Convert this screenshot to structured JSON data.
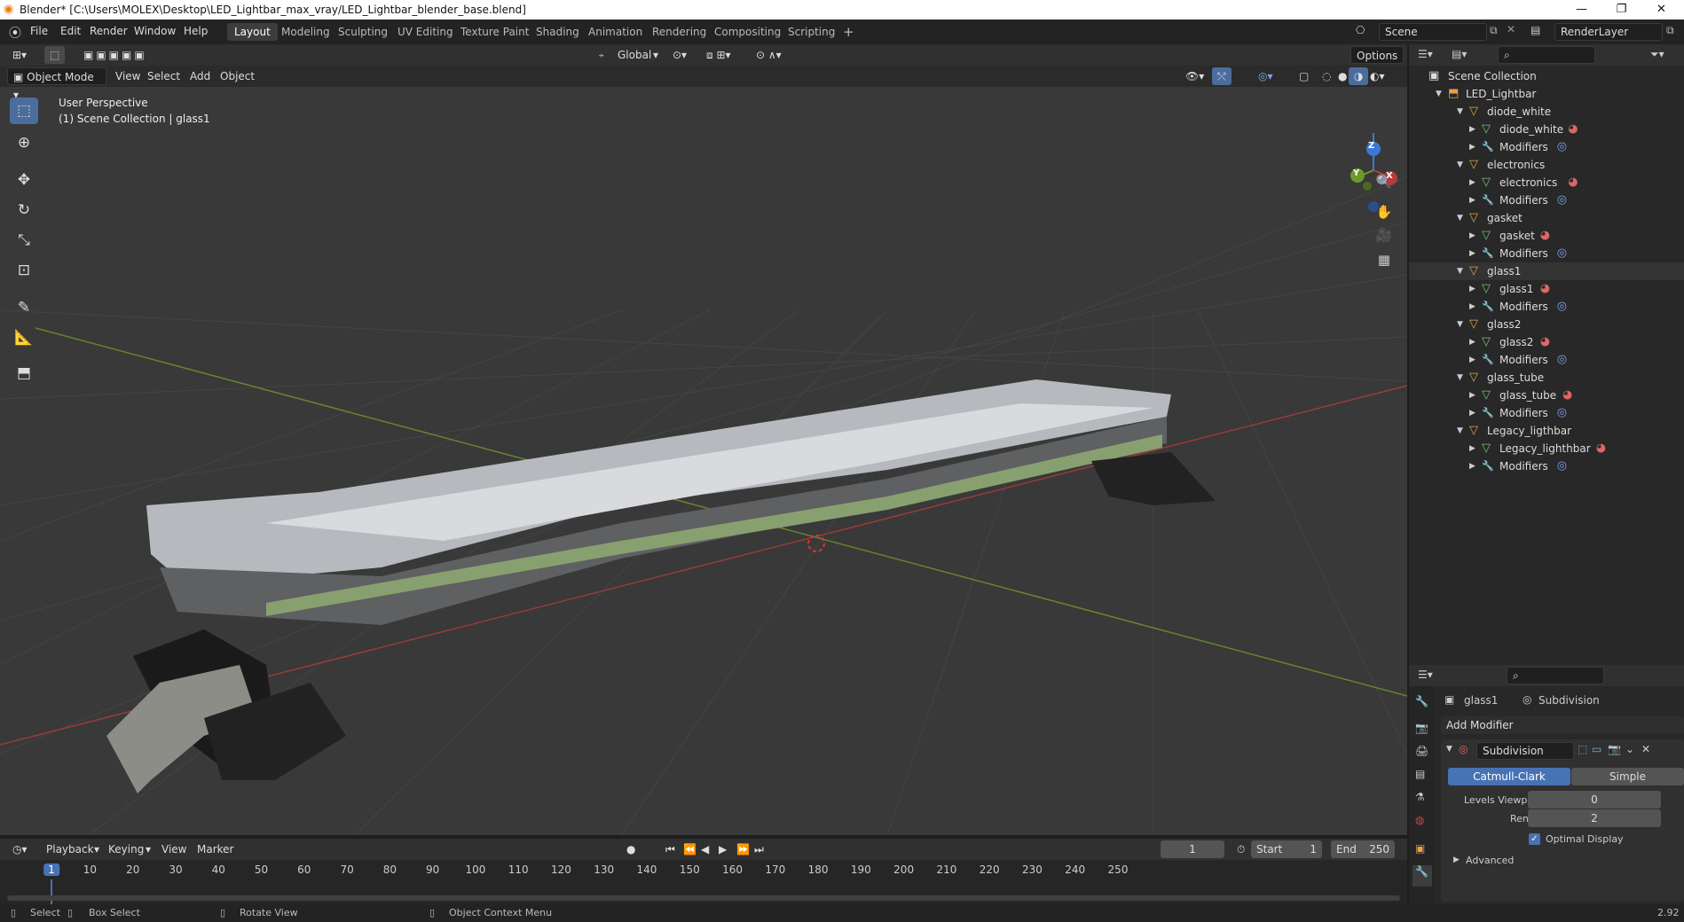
{
  "window": {
    "title": "Blender* [C:\\Users\\MOLEX\\Desktop\\LED_Lightbar_max_vray/LED_Lightbar_blender_base.blend]",
    "controls": [
      "—",
      "❐",
      "✕"
    ]
  },
  "menu": [
    "File",
    "Edit",
    "Render",
    "Window",
    "Help"
  ],
  "workspaces": [
    "Layout",
    "Modeling",
    "Sculpting",
    "UV Editing",
    "Texture Paint",
    "Shading",
    "Animation",
    "Rendering",
    "Compositing",
    "Scripting"
  ],
  "scene": {
    "name": "Scene",
    "render_layer": "RenderLayer"
  },
  "viewport": {
    "mode": "Object Mode",
    "menus": [
      "View",
      "Select",
      "Add",
      "Object"
    ],
    "transform_orientation": "Global",
    "options_label": "Options",
    "info_line1": "User Perspective",
    "info_line2": "(1) Scene Collection | glass1",
    "gizmo": {
      "x": "X",
      "y": "Y",
      "z": "Z"
    }
  },
  "outliner": {
    "root": "Scene Collection",
    "collection": "LED_Lightbar",
    "rows": [
      {
        "label": "diode_white",
        "kind": "object"
      },
      {
        "label": "diode_white",
        "kind": "mesh"
      },
      {
        "label": "Modifiers",
        "kind": "modifiers"
      },
      {
        "label": "electronics",
        "kind": "object"
      },
      {
        "label": "electronics",
        "kind": "mesh"
      },
      {
        "label": "Modifiers",
        "kind": "modifiers"
      },
      {
        "label": "gasket",
        "kind": "object"
      },
      {
        "label": "gasket",
        "kind": "mesh"
      },
      {
        "label": "Modifiers",
        "kind": "modifiers"
      },
      {
        "label": "glass1",
        "kind": "object"
      },
      {
        "label": "glass1",
        "kind": "mesh"
      },
      {
        "label": "Modifiers",
        "kind": "modifiers"
      },
      {
        "label": "glass2",
        "kind": "object"
      },
      {
        "label": "glass2",
        "kind": "mesh"
      },
      {
        "label": "Modifiers",
        "kind": "modifiers"
      },
      {
        "label": "glass_tube",
        "kind": "object"
      },
      {
        "label": "glass_tube",
        "kind": "mesh"
      },
      {
        "label": "Modifiers",
        "kind": "modifiers"
      },
      {
        "label": "Legacy_ligthbar",
        "kind": "object"
      },
      {
        "label": "Legacy_lighthbar",
        "kind": "mesh"
      },
      {
        "label": "Modifiers",
        "kind": "modifiers"
      }
    ]
  },
  "properties": {
    "object": "glass1",
    "modifier_crumb": "Subdivision",
    "add_modifier": "Add Modifier",
    "modifier": {
      "name": "Subdivision",
      "tab_active": "Catmull-Clark",
      "tab_other": "Simple",
      "levels_viewport_label": "Levels Viewport",
      "levels_viewport": "0",
      "render_label": "Render",
      "render": "2",
      "optimal_display": "Optimal Display",
      "advanced": "Advanced"
    }
  },
  "timeline": {
    "menus": [
      "Playback",
      "Keying",
      "View",
      "Marker"
    ],
    "current_frame": "1",
    "start_label": "Start",
    "start": "1",
    "end_label": "End",
    "end": "250",
    "ticks": [
      "1",
      "10",
      "20",
      "30",
      "40",
      "50",
      "60",
      "70",
      "80",
      "90",
      "100",
      "110",
      "120",
      "130",
      "140",
      "150",
      "160",
      "170",
      "180",
      "190",
      "200",
      "210",
      "220",
      "230",
      "240",
      "250"
    ]
  },
  "status": {
    "select": "Select",
    "box_select": "Box Select",
    "rotate_view": "Rotate View",
    "context_menu": "Object Context Menu",
    "version": "2.92"
  },
  "colors": {
    "accent": "#4772b3",
    "x_axis": "#b43c3c",
    "y_axis": "#6e9a2c",
    "z_axis": "#3c78d8"
  }
}
